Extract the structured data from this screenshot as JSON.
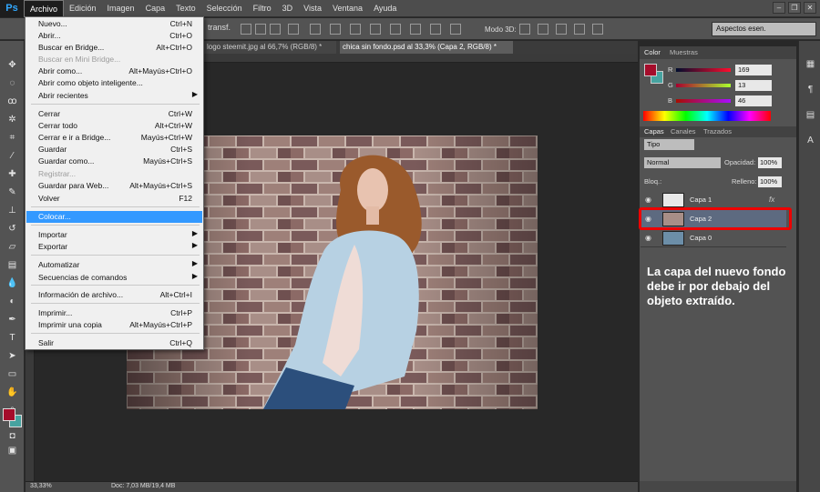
{
  "app": {
    "logo": "Ps"
  },
  "menubar": {
    "items": [
      "Archivo",
      "Edición",
      "Imagen",
      "Capa",
      "Texto",
      "Selección",
      "Filtro",
      "3D",
      "Vista",
      "Ventana",
      "Ayuda"
    ]
  },
  "options": {
    "transf_label": "transf.",
    "mode_3d": "Modo 3D:",
    "workspace": "Aspectos esen."
  },
  "tabs": [
    {
      "label": "logo steemit.jpg al 66,7% (RGB/8) *"
    },
    {
      "label": "chica sin fondo.psd al 33,3% (Capa 2, RGB/8) *"
    }
  ],
  "archivo_menu": {
    "items": [
      {
        "label": "Nuevo...",
        "shortcut": "Ctrl+N"
      },
      {
        "label": "Abrir...",
        "shortcut": "Ctrl+O"
      },
      {
        "label": "Buscar en Bridge...",
        "shortcut": "Alt+Ctrl+O"
      },
      {
        "label": "Buscar en Mini Bridge...",
        "shortcut": "",
        "disabled": true
      },
      {
        "label": "Abrir como...",
        "shortcut": "Alt+Mayús+Ctrl+O"
      },
      {
        "label": "Abrir como objeto inteligente...",
        "shortcut": ""
      },
      {
        "label": "Abrir recientes",
        "shortcut": "",
        "submenu": true
      },
      {
        "label": "Cerrar",
        "shortcut": "Ctrl+W"
      },
      {
        "label": "Cerrar todo",
        "shortcut": "Alt+Ctrl+W"
      },
      {
        "label": "Cerrar e ir a Bridge...",
        "shortcut": "Mayús+Ctrl+W"
      },
      {
        "label": "Guardar",
        "shortcut": "Ctrl+S"
      },
      {
        "label": "Guardar como...",
        "shortcut": "Mayús+Ctrl+S"
      },
      {
        "label": "Registrar...",
        "shortcut": "",
        "disabled": true
      },
      {
        "label": "Guardar para Web...",
        "shortcut": "Alt+Mayús+Ctrl+S"
      },
      {
        "label": "Volver",
        "shortcut": "F12"
      },
      {
        "label": "Colocar...",
        "shortcut": "",
        "highlighted": true
      },
      {
        "label": "Importar",
        "shortcut": "",
        "submenu": true
      },
      {
        "label": "Exportar",
        "shortcut": "",
        "submenu": true
      },
      {
        "label": "Automatizar",
        "shortcut": "",
        "submenu": true
      },
      {
        "label": "Secuencias de comandos",
        "shortcut": "",
        "submenu": true
      },
      {
        "label": "Información de archivo...",
        "shortcut": "Alt+Ctrl+I"
      },
      {
        "label": "Imprimir...",
        "shortcut": "Ctrl+P"
      },
      {
        "label": "Imprimir una copia",
        "shortcut": "Alt+Mayús+Ctrl+P"
      },
      {
        "label": "Salir",
        "shortcut": "Ctrl+Q"
      }
    ]
  },
  "color_panel": {
    "tabs": [
      "Color",
      "Muestras"
    ],
    "r": {
      "label": "R",
      "value": "169"
    },
    "g": {
      "label": "G",
      "value": "13"
    },
    "b": {
      "label": "B",
      "value": "46"
    },
    "foreground": "#a50d2b",
    "background": "#46a3a0"
  },
  "layers_panel": {
    "tabs": [
      "Capas",
      "Canales",
      "Trazados"
    ],
    "filter": "Tipo",
    "blend_mode": "Normal",
    "opacity_label": "Opacidad:",
    "opacity": "100%",
    "lock_label": "Bloq.:",
    "fill_label": "Relleno:",
    "fill": "100%",
    "layers": [
      {
        "name": "Capa 1",
        "selected": false
      },
      {
        "name": "Capa 2",
        "selected": true
      },
      {
        "name": "Capa 0",
        "selected": false
      }
    ]
  },
  "status": {
    "zoom": "33,33%",
    "doc": "Doc: 7,03 MB/19,4 MB"
  },
  "annotation": "La capa del nuevo fondo debe ir por debajo del objeto extraído.",
  "accent_highlight": "#e00000"
}
